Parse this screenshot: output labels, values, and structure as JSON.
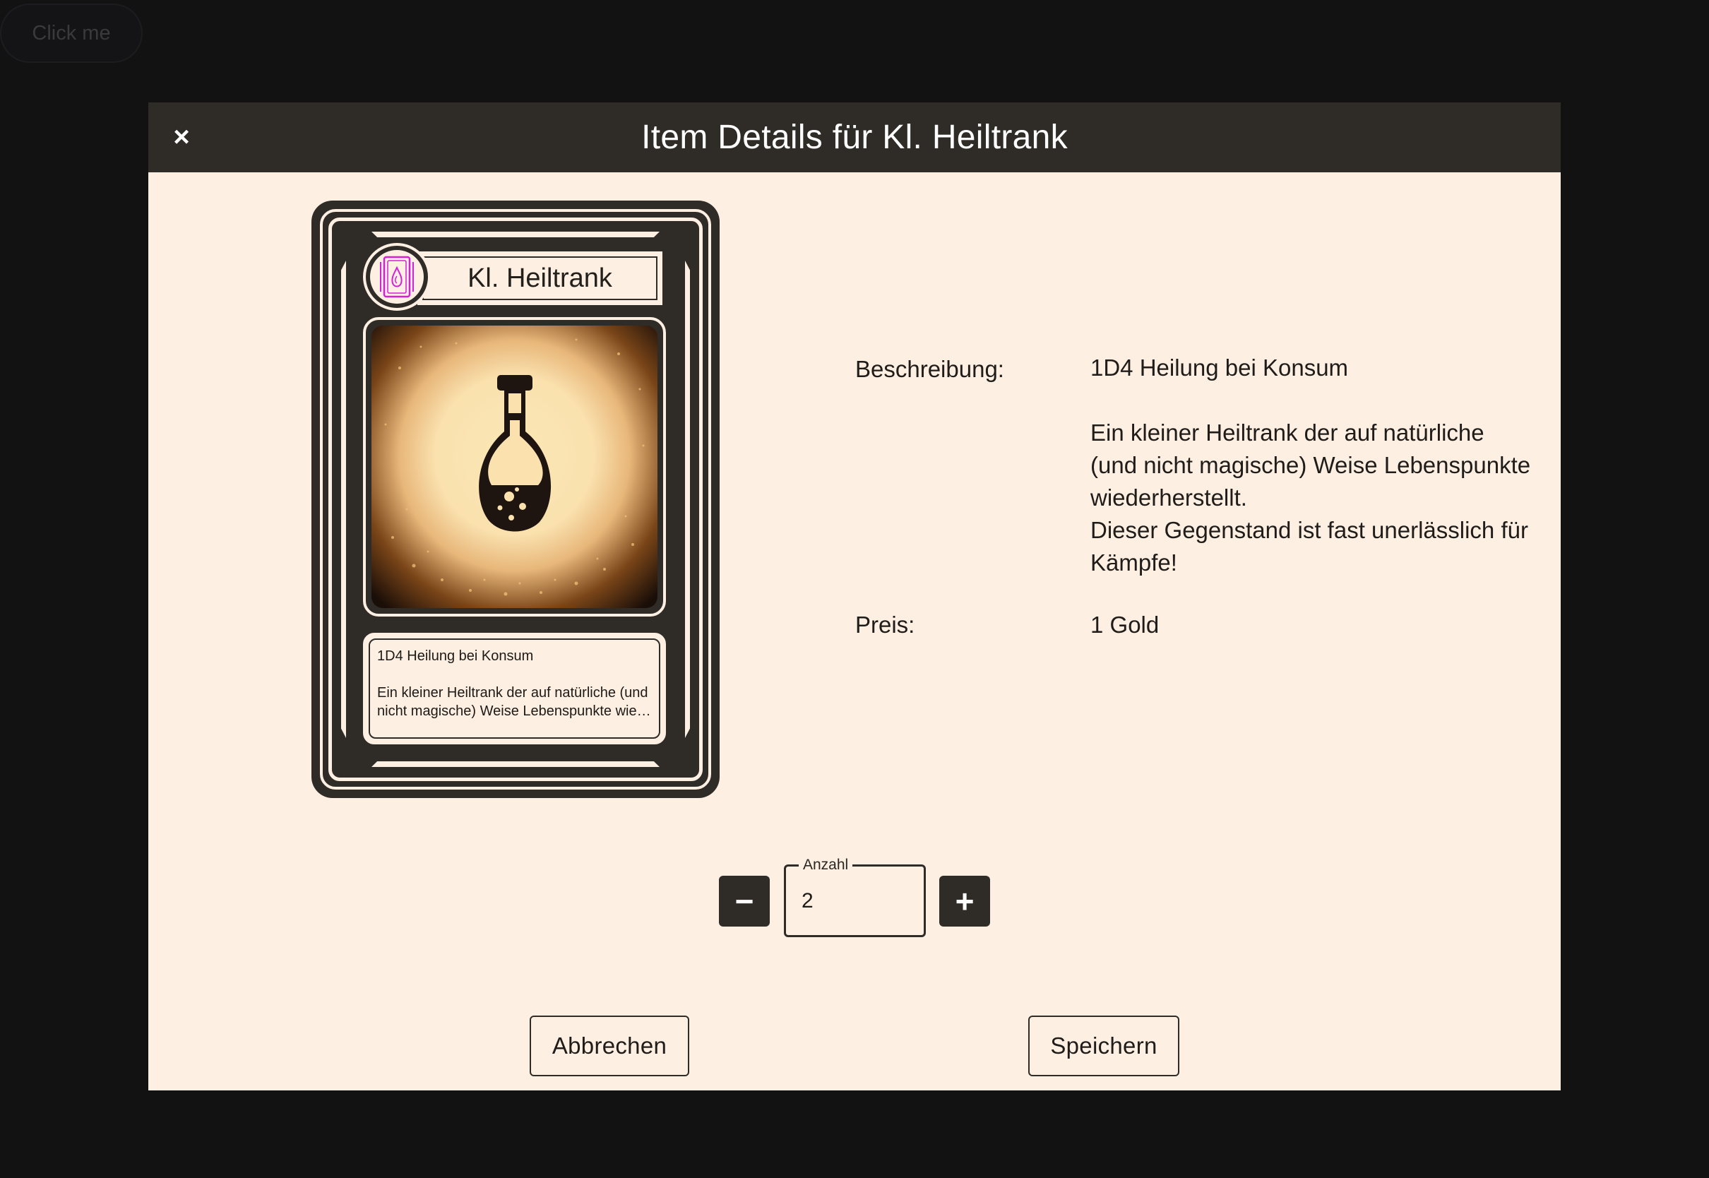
{
  "background": {
    "button_label": "Click me"
  },
  "dialog": {
    "title": "Item Details für Kl. Heiltrank",
    "close_icon": "×"
  },
  "card": {
    "name": "Kl. Heiltrank",
    "badge_icon": "potion-card-icon",
    "image": "potion-bottle-illustration",
    "text_line1": "1D4 Heilung bei Konsum",
    "text_line2": "Ein kleiner Heiltrank der auf natürliche (und",
    "text_line3": "nicht magische) Weise Lebenspunkte wied..."
  },
  "details": {
    "description_label": "Beschreibung:",
    "description_lines": [
      "1D4 Heilung bei Konsum",
      "",
      "Ein kleiner Heiltrank der auf natürliche",
      "(und nicht magische) Weise Lebenspunkte",
      "wiederherstellt.",
      "Dieser Gegenstand ist fast unerlässlich für",
      "Kämpfe!"
    ],
    "price_label": "Preis:",
    "price_value": "1 Gold"
  },
  "quantity": {
    "label": "Anzahl",
    "value": "2",
    "decrement_icon": "−",
    "increment_icon": "+"
  },
  "actions": {
    "cancel_label": "Abbrechen",
    "save_label": "Speichern"
  },
  "colors": {
    "page_background": "#121213",
    "dialog_background": "#fdefe2",
    "header_background": "#2f2c27",
    "dark_accent": "#2f2c28",
    "badge_icon_color": "#d81fd8"
  }
}
